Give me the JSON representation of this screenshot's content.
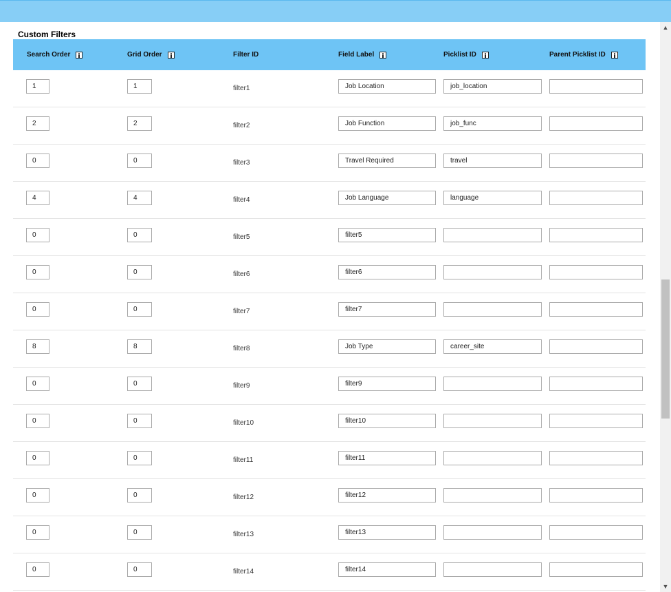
{
  "section": {
    "title": "Custom Filters"
  },
  "header": {
    "search_order": "Search Order",
    "grid_order": "Grid Order",
    "filter_id": "Filter ID",
    "field_label": "Field Label",
    "picklist_id": "Picklist ID",
    "parent_picklist_id": "Parent Picklist ID"
  },
  "rows": [
    {
      "search_order": "1",
      "grid_order": "1",
      "filter_id": "filter1",
      "field_label": "Job Location",
      "picklist_id": "job_location",
      "parent_picklist_id": ""
    },
    {
      "search_order": "2",
      "grid_order": "2",
      "filter_id": "filter2",
      "field_label": "Job Function",
      "picklist_id": "job_func",
      "parent_picklist_id": ""
    },
    {
      "search_order": "0",
      "grid_order": "0",
      "filter_id": "filter3",
      "field_label": "Travel Required",
      "picklist_id": "travel",
      "parent_picklist_id": ""
    },
    {
      "search_order": "4",
      "grid_order": "4",
      "filter_id": "filter4",
      "field_label": "Job Language",
      "picklist_id": "language",
      "parent_picklist_id": ""
    },
    {
      "search_order": "0",
      "grid_order": "0",
      "filter_id": "filter5",
      "field_label": "filter5",
      "picklist_id": "",
      "parent_picklist_id": ""
    },
    {
      "search_order": "0",
      "grid_order": "0",
      "filter_id": "filter6",
      "field_label": "filter6",
      "picklist_id": "",
      "parent_picklist_id": ""
    },
    {
      "search_order": "0",
      "grid_order": "0",
      "filter_id": "filter7",
      "field_label": "filter7",
      "picklist_id": "",
      "parent_picklist_id": ""
    },
    {
      "search_order": "8",
      "grid_order": "8",
      "filter_id": "filter8",
      "field_label": "Job Type",
      "picklist_id": "career_site",
      "parent_picklist_id": ""
    },
    {
      "search_order": "0",
      "grid_order": "0",
      "filter_id": "filter9",
      "field_label": "filter9",
      "picklist_id": "",
      "parent_picklist_id": ""
    },
    {
      "search_order": "0",
      "grid_order": "0",
      "filter_id": "filter10",
      "field_label": "filter10",
      "picklist_id": "",
      "parent_picklist_id": ""
    },
    {
      "search_order": "0",
      "grid_order": "0",
      "filter_id": "filter11",
      "field_label": "filter11",
      "picklist_id": "",
      "parent_picklist_id": ""
    },
    {
      "search_order": "0",
      "grid_order": "0",
      "filter_id": "filter12",
      "field_label": "filter12",
      "picklist_id": "",
      "parent_picklist_id": ""
    },
    {
      "search_order": "0",
      "grid_order": "0",
      "filter_id": "filter13",
      "field_label": "filter13",
      "picklist_id": "",
      "parent_picklist_id": ""
    },
    {
      "search_order": "0",
      "grid_order": "0",
      "filter_id": "filter14",
      "field_label": "filter14",
      "picklist_id": "",
      "parent_picklist_id": ""
    }
  ],
  "colors": {
    "top_bar": "#87cef6",
    "header_bg": "#6ec4f5"
  },
  "icons": {
    "info": "info-icon",
    "scroll_up": "chevron-up-icon",
    "scroll_down": "chevron-down-icon"
  }
}
